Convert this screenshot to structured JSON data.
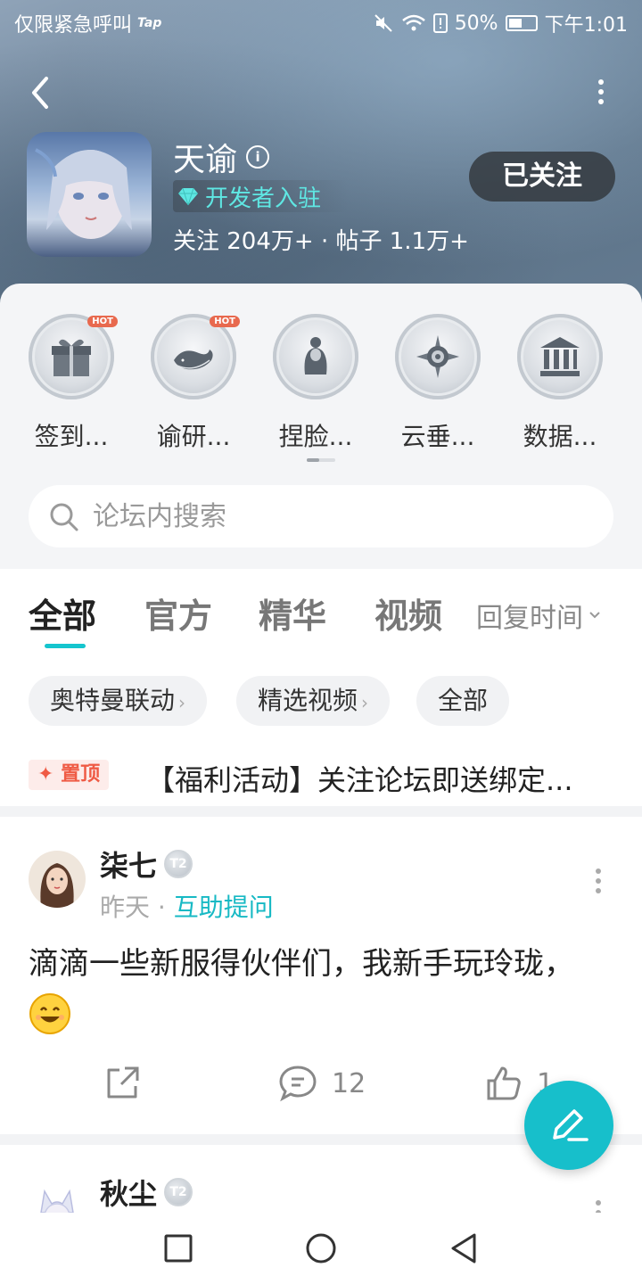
{
  "status_bar": {
    "carrier": "仅限紧急呼叫",
    "carrier_logo": "Tap",
    "battery": "50%",
    "time": "下午1:01"
  },
  "header": {
    "game_name": "天谕",
    "badge": "开发者入驻",
    "stats": "关注 204万+ · 帖子 1.1万+",
    "follow_button": "已关注"
  },
  "shortcuts": [
    {
      "label": "签到...",
      "icon": "gift-icon",
      "hot": "HOT"
    },
    {
      "label": "谕研...",
      "icon": "whale-icon",
      "hot": "HOT"
    },
    {
      "label": "捏脸...",
      "icon": "woman-silhouette-icon",
      "hot": ""
    },
    {
      "label": "云垂...",
      "icon": "compass-icon",
      "hot": ""
    },
    {
      "label": "数据...",
      "icon": "library-icon",
      "hot": ""
    }
  ],
  "search": {
    "placeholder": "论坛内搜索"
  },
  "tabs": {
    "items": [
      "全部",
      "官方",
      "精华",
      "视频"
    ],
    "active": "全部",
    "sort_label": "回复时间"
  },
  "chips": [
    "奥特曼联动",
    "精选视频",
    "全部"
  ],
  "pinned": {
    "badge": "置顶",
    "title": "【福利活动】关注论坛即送绑定..."
  },
  "posts": [
    {
      "author": "柒七",
      "level": "T2",
      "time": "昨天",
      "separator": "·",
      "tag": "互助提问",
      "body": "滴滴一些新服得伙伴们，我新手玩玲珑，",
      "comments": "12",
      "likes": "1"
    },
    {
      "author": "秋尘",
      "level": "T2"
    }
  ],
  "colors": {
    "accent": "#17bfcb",
    "pin": "#ef5b45",
    "dev_badge": "#5fe7e3"
  }
}
